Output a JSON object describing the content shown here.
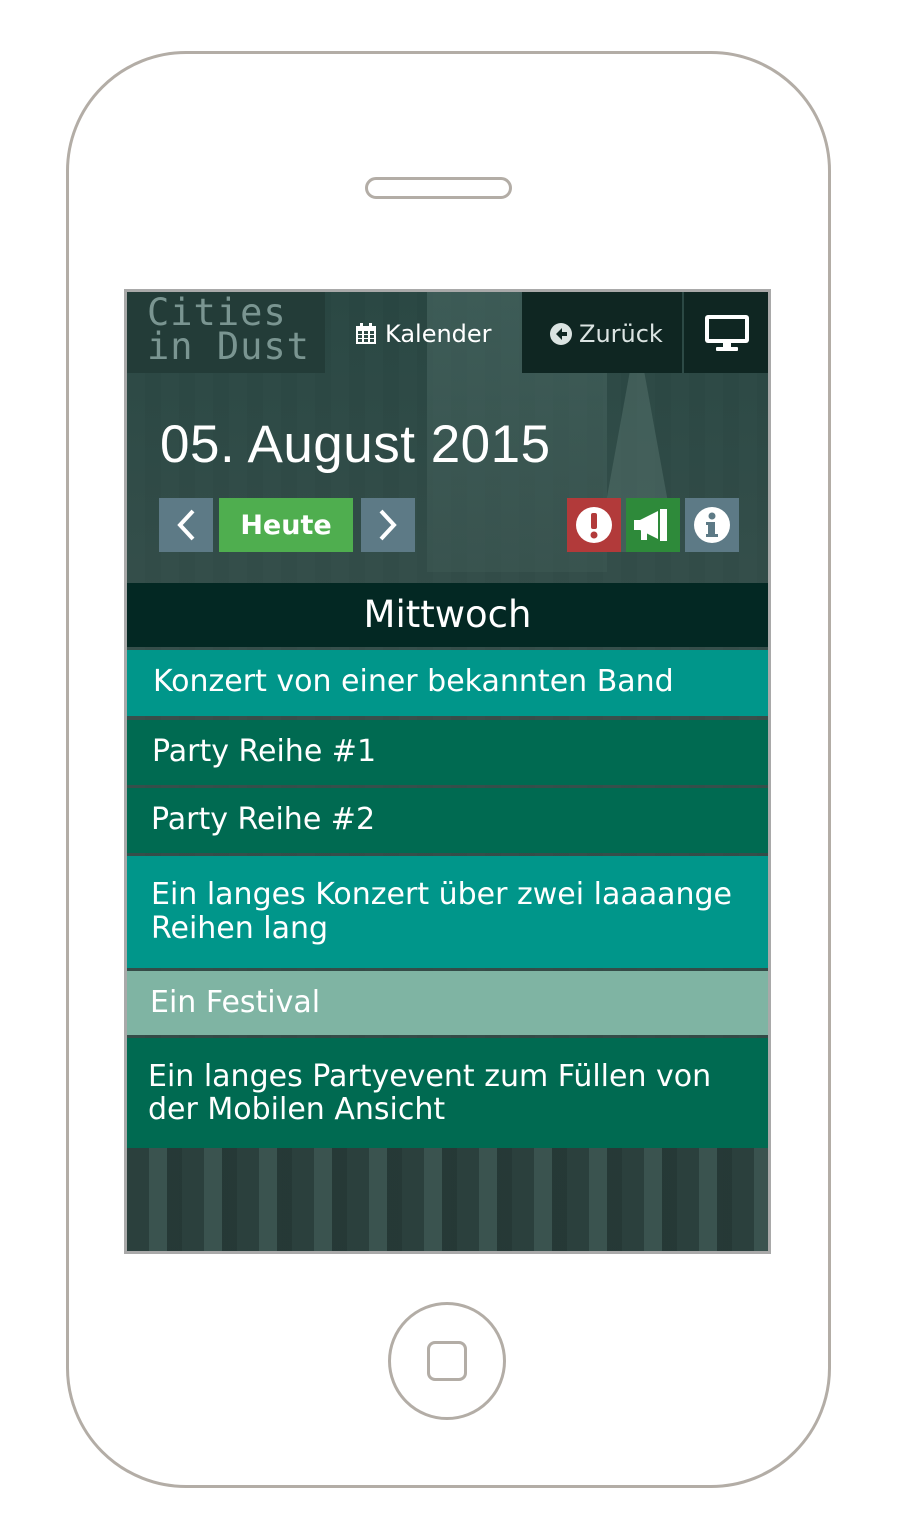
{
  "app": {
    "logo_line1": "Cities",
    "logo_line2": "in Dust"
  },
  "nav": {
    "calendar_label": "Kalender",
    "back_label": "Zurück",
    "desktop_icon": "desktop-icon"
  },
  "date": {
    "title": "05. August 2015"
  },
  "controls": {
    "prev_icon": "chevron-left-icon",
    "today_label": "Heute",
    "next_icon": "chevron-right-icon",
    "warning_icon": "exclamation-circle-icon",
    "promo_icon": "bullhorn-icon",
    "info_icon": "info-circle-icon"
  },
  "day": {
    "name": "Mittwoch"
  },
  "events": [
    {
      "title": "Konzert von einer bekannten Band",
      "color": "#00968a"
    },
    {
      "title": "Party Reihe #1",
      "color": "#006a51"
    },
    {
      "title": "Party Reihe #2",
      "color": "#006a51"
    },
    {
      "title": "Ein langes Konzert über zwei laaaange Reihen lang",
      "color": "#00968a"
    },
    {
      "title": "Ein Festival",
      "color": "#7fb4a3"
    },
    {
      "title": "Ein langes Partyevent zum Füllen von der Mobilen Ansicht",
      "color": "#006a51"
    }
  ],
  "colors": {
    "day_header_bg": "#032823",
    "today_button": "#4fae4f",
    "warning_button": "#b23a3a",
    "promo_button": "#2e8a3a",
    "nav_button": "#5d7a86"
  }
}
